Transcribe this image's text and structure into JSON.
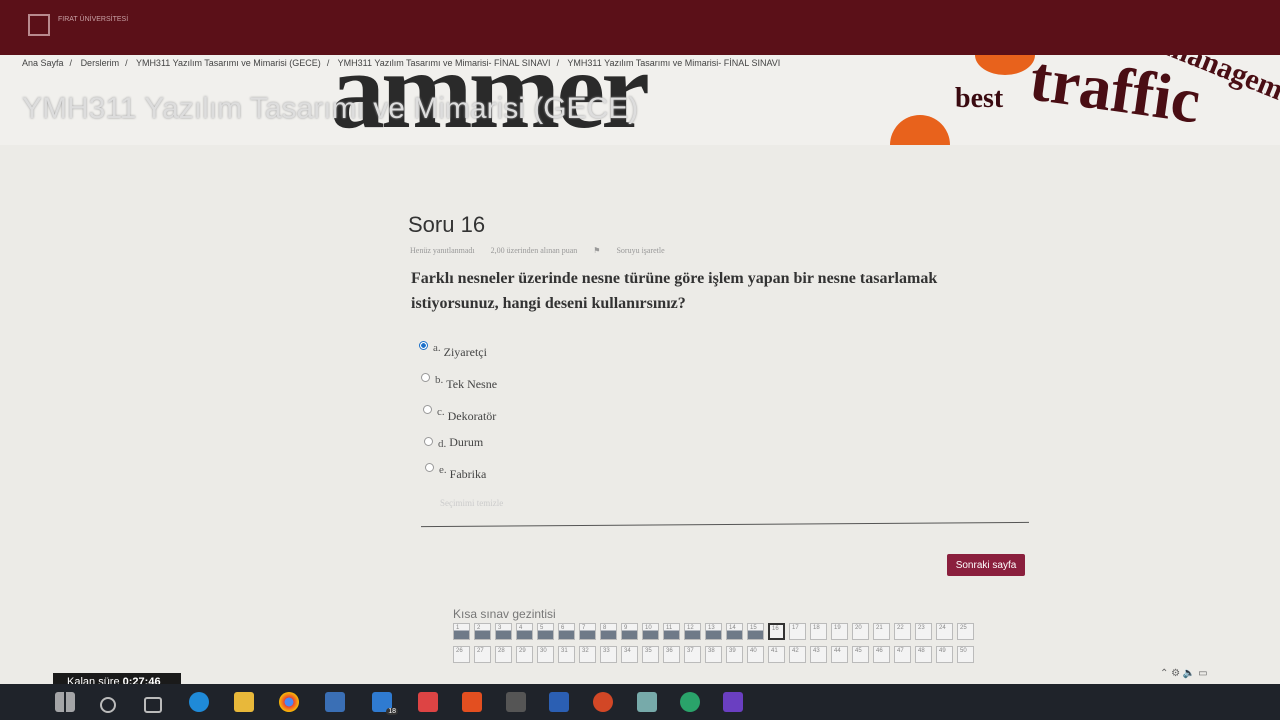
{
  "header": {
    "logo_text": "FIRAT ÜNİVERSİTESİ"
  },
  "banner": {
    "words": [
      "ammer",
      "traffic",
      "management",
      "best"
    ]
  },
  "breadcrumb": [
    "Ana Sayfa",
    "Derslerim",
    "YMH311 Yazılım Tasarımı ve Mimarisi (GECE)",
    "YMH311 Yazılım Tasarımı ve Mimarisi- FİNAL SINAVI",
    "YMH311 Yazılım Tasarımı ve Mimarisi- FİNAL SINAVI"
  ],
  "course_title": "YMH311 Yazılım Tasarımı ve Mimarisi (GECE)",
  "question": {
    "title": "Soru 16",
    "status": "Henüz yanıtlanmadı",
    "points": "2,00 üzerinden alınan puan",
    "flag": "Soruyu işaretle",
    "text": "Farklı nesneler üzerinde nesne türüne göre işlem yapan bir nesne tasarlamak istiyorsunuz, hangi deseni kullanırsınız?",
    "options": [
      {
        "letter": "a.",
        "label": "Ziyaretçi",
        "selected": true
      },
      {
        "letter": "b.",
        "label": "Tek Nesne",
        "selected": false
      },
      {
        "letter": "c.",
        "label": "Dekoratör",
        "selected": false
      },
      {
        "letter": "d.",
        "label": "Durum",
        "selected": false
      },
      {
        "letter": "e.",
        "label": "Fabrika",
        "selected": false
      }
    ],
    "clear_choice": "Seçimimi temizle"
  },
  "next_button": "Sonraki sayfa",
  "quiz_nav": {
    "title": "Kısa sınav gezintisi",
    "current": 16,
    "answered_count": 15,
    "total": 50
  },
  "timer": {
    "label": "Kalan süre",
    "value": "0:27:46"
  },
  "taskbar": {
    "mail_badge": "18"
  },
  "colors": {
    "topbar": "#5b1018",
    "accent_button": "#8a1f3d",
    "radio_selected": "#1a6fc9"
  }
}
